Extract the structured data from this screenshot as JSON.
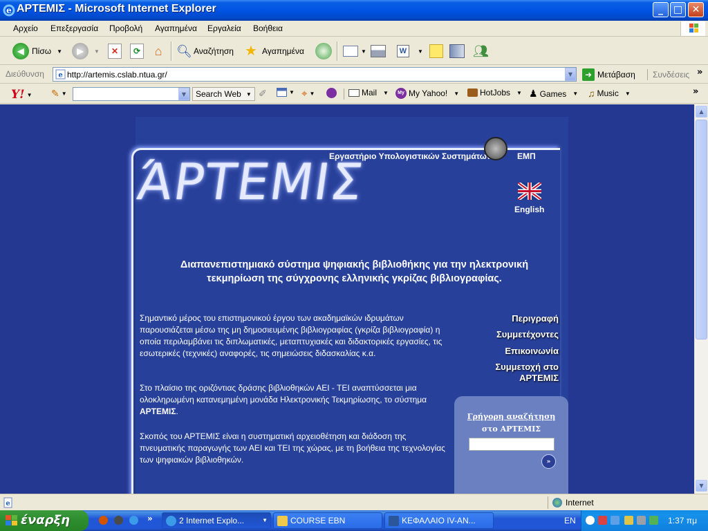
{
  "window": {
    "title": "ΑΡΤΕΜΙΣ - Microsoft Internet Explorer",
    "minimize": "_",
    "maximize": "□",
    "close": "✕"
  },
  "menu": [
    "Αρχείο",
    "Επεξεργασία",
    "Προβολή",
    "Αγαπημένα",
    "Εργαλεία",
    "Βοήθεια"
  ],
  "toolbar": {
    "back": "Πίσω",
    "search": "Αναζήτηση",
    "favorites": "Αγαπημένα"
  },
  "address": {
    "label": "Διεύθυνση",
    "url": "http://artemis.cslab.ntua.gr/",
    "go": "Μετάβαση",
    "links": "Συνδέσεις",
    "chevron": "»"
  },
  "yahoo": {
    "search_web": "Search Web",
    "mail": "Mail",
    "my_yahoo": "My Yahoo!",
    "hotjobs": "HotJobs",
    "games": "Games",
    "music": "Music",
    "chevron": "»"
  },
  "page": {
    "logo": "ΆΡΤΕΜΙΣ",
    "lab": "Εργαστήριο Υπολογιστικών Συστημάτων",
    "emp": "ΕΜΠ",
    "english": "English",
    "tagline": "Διαπανεπιστημιακό σύστημα ψηφιακής βιβλιοθήκης για την ηλεκτρονική τεκμηρίωση της σύγχρονης ελληνικής γκρίζας βιβλιογραφίας.",
    "para1": "Σημαντικό μέρος του επιστημονικού έργου των ακαδημαϊκών ιδρυμάτων παρουσιάζεται μέσω της μη δημοσιευμένης βιβλιογραφίας (γκρίζα βιβλιογραφία) η οποία περιλαμβάνει τις διπλωματικές, μεταπτυχιακές και διδακτορικές εργασίες, τις εσωτερικές (τεχνικές) αναφορές, τις σημειώσεις διδασκαλίας κ.α.",
    "para2_pre": "Στο πλαίσιο της οριζόντιας δράσης βιβλιοθηκών ΑΕΙ - ΤΕΙ αναπτύσσεται μια ολοκληρωμένη κατανεμημένη μονάδα Ηλεκτρονικής Τεκμηρίωσης, το σύστημα ",
    "para2_bold": "ΑΡΤΕΜΙΣ",
    "para2_post": ".",
    "para3": "Σκοπός του ΑΡΤΕΜΙΣ είναι η συστηματική αρχειοθέτηση και διάδοση της πνευματικής παραγωγής των ΑΕΙ και ΤΕΙ της χώρας, με τη βοήθεια της τεχνολογίας των ψηφιακών βιβλιοθηκών.",
    "nav": {
      "description": "Περιγραφή",
      "participants": "Συμμετέχοντες",
      "contact": "Επικοινωνία",
      "join_line1": "Συμμετοχή στο",
      "join_line2": "ΑΡΤΕΜΙΣ"
    },
    "quick_search": {
      "title": "Γρήγορη αναζήτηση",
      "subtitle": "στο ΑΡΤΕΜΙΣ",
      "go": "»"
    }
  },
  "status": {
    "zone": "Internet"
  },
  "taskbar": {
    "start": "έναρξη",
    "tasks": [
      "2 Internet Explo...",
      "COURSE EBN",
      "ΚΕΦΑΛΑΙΟ IV-AN..."
    ],
    "lang": "EN",
    "clock": "1:37 πμ"
  }
}
